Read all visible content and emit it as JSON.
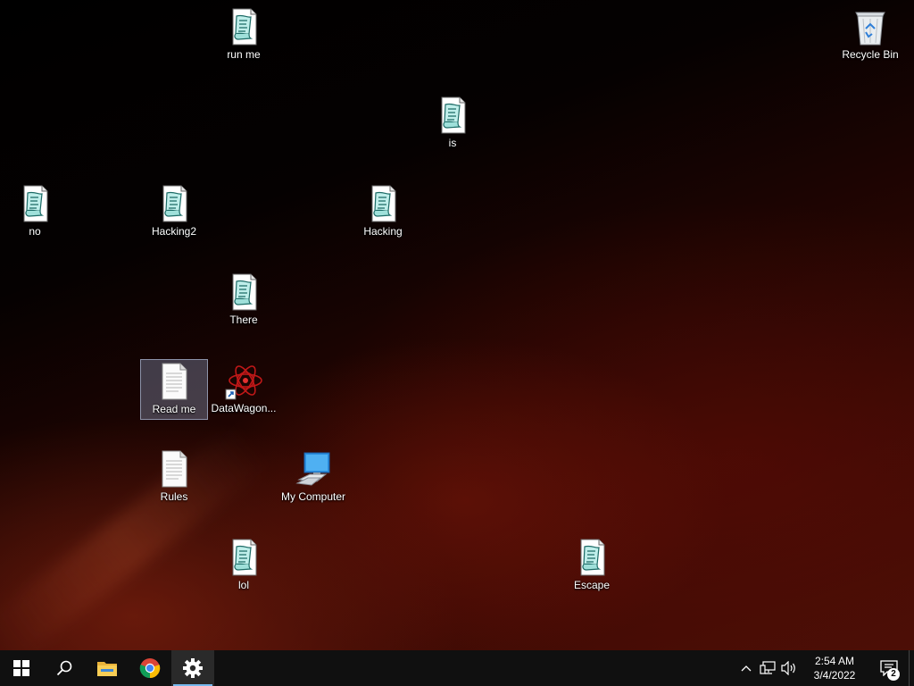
{
  "desktop": {
    "icons": {
      "run_me": "run me",
      "recycle_bin": "Recycle Bin",
      "is": "is",
      "no": "no",
      "hacking2": "Hacking2",
      "hacking": "Hacking",
      "there": "There",
      "read_me": "Read me",
      "datawagon": "DataWagon...",
      "rules": "Rules",
      "my_computer": "My Computer",
      "lol": "lol",
      "escape": "Escape"
    },
    "selected_icon": "Read me"
  },
  "taskbar": {
    "pinned": [
      "start-button",
      "search-icon",
      "file-explorer-icon",
      "chrome-icon",
      "settings-icon"
    ],
    "active": "settings-icon",
    "active_indicator_color": "#76b9ed",
    "clock": {
      "time": "2:54 AM",
      "date": "3/4/2022"
    },
    "notification_count": "2"
  }
}
